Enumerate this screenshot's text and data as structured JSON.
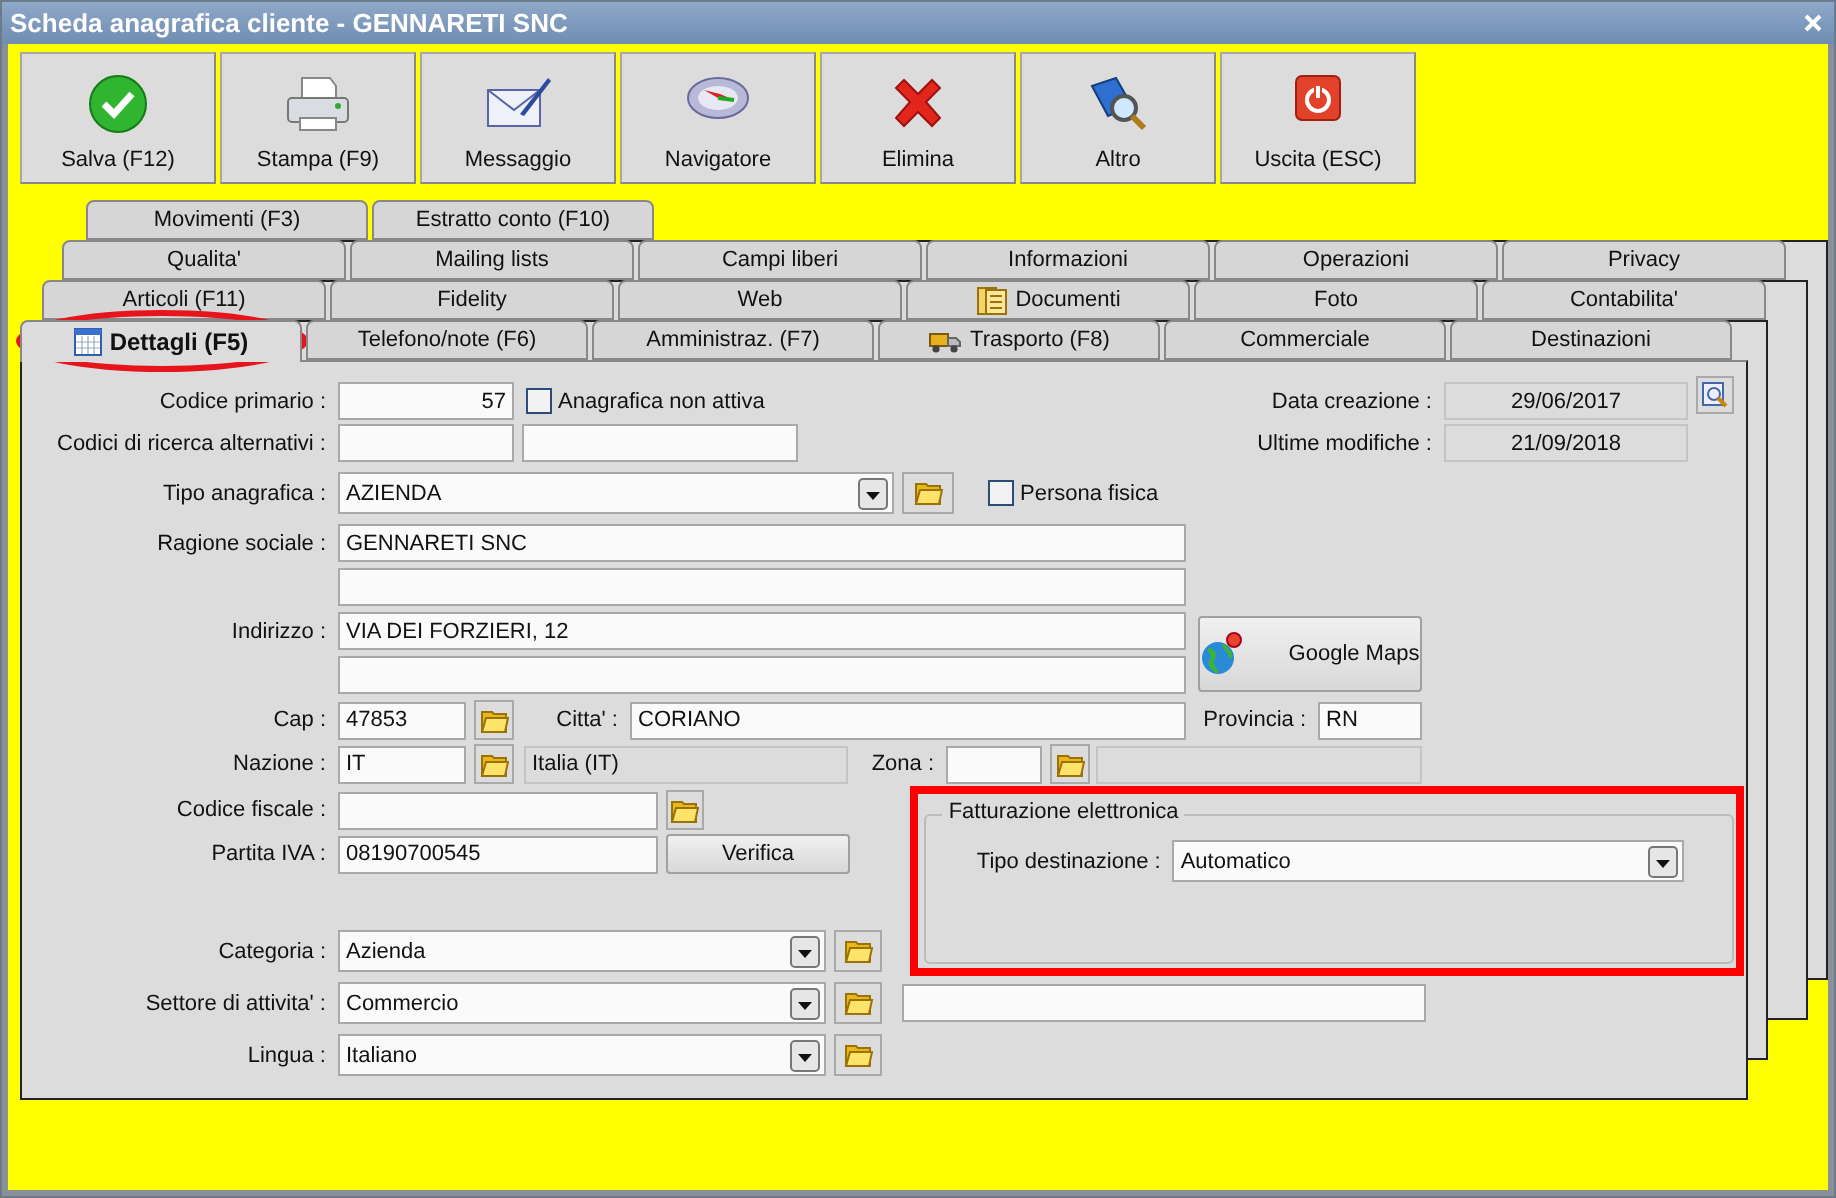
{
  "window": {
    "title": "Scheda anagrafica cliente - GENNARETI SNC"
  },
  "toolbar": [
    "Salva (F12)",
    "Stampa (F9)",
    "Messaggio",
    "Navigatore",
    "Elimina",
    "Altro",
    "Uscita (ESC)"
  ],
  "tab_rows": [
    [
      {
        "label": "Movimenti (F3)",
        "selected": false
      },
      {
        "label": "Estratto conto (F10)",
        "selected": false
      }
    ],
    [
      {
        "label": "Qualita'",
        "selected": false
      },
      {
        "label": "Mailing lists",
        "selected": false
      },
      {
        "label": "Campi liberi",
        "selected": false
      },
      {
        "label": "Informazioni",
        "selected": false
      },
      {
        "label": "Operazioni",
        "selected": false
      },
      {
        "label": "Privacy",
        "selected": false
      }
    ],
    [
      {
        "label": "Articoli (F11)",
        "selected": false
      },
      {
        "label": "Fidelity",
        "selected": false
      },
      {
        "label": "Web",
        "selected": false
      },
      {
        "label": "Documenti",
        "selected": false
      },
      {
        "label": "Foto",
        "selected": false
      },
      {
        "label": "Contabilita'",
        "selected": false
      }
    ],
    [
      {
        "label": "Dettagli (F5)",
        "selected": true
      },
      {
        "label": "Telefono/note (F6)",
        "selected": false
      },
      {
        "label": "Amministraz. (F7)",
        "selected": false
      },
      {
        "label": "Trasporto (F8)",
        "selected": false
      },
      {
        "label": "Commerciale",
        "selected": false
      },
      {
        "label": "Destinazioni",
        "selected": false
      }
    ]
  ],
  "form": {
    "codice_primario": {
      "label": "Codice primario :",
      "value": "57"
    },
    "non_attiva": {
      "label": "Anagrafica non attiva",
      "checked": false
    },
    "data_creazione": {
      "label": "Data creazione :",
      "value": "29/06/2017"
    },
    "codici_alternativi": {
      "label": "Codici di ricerca alternativi :"
    },
    "ultime_modifiche": {
      "label": "Ultime modifiche :",
      "value": "21/09/2018"
    },
    "tipo_anagrafica": {
      "label": "Tipo anagrafica :",
      "value": "AZIENDA"
    },
    "persona_fisica": {
      "label": "Persona fisica",
      "checked": false
    },
    "ragione_sociale": {
      "label": "Ragione sociale :",
      "value": "GENNARETI SNC"
    },
    "indirizzo": {
      "label": "Indirizzo :",
      "value": "VIA DEI FORZIERI, 12"
    },
    "google_maps_button": "Google Maps",
    "cap": {
      "label": "Cap :",
      "value": "47853"
    },
    "citta": {
      "label": "Citta' :",
      "value": "CORIANO"
    },
    "provincia": {
      "label": "Provincia :",
      "value": "RN"
    },
    "nazione": {
      "label": "Nazione :",
      "value": "IT",
      "description": "Italia (IT)"
    },
    "zona": {
      "label": "Zona :"
    },
    "codice_fiscale": {
      "label": "Codice fiscale :"
    },
    "partita_iva": {
      "label": "Partita IVA :",
      "value": "08190700545"
    },
    "verifica_button": "Verifica",
    "fatturazione": {
      "title": "Fatturazione elettronica",
      "label": "Tipo destinazione :",
      "value": "Automatico"
    },
    "categoria": {
      "label": "Categoria :",
      "value": "Azienda"
    },
    "settore": {
      "label": "Settore di attivita' :",
      "value": "Commercio"
    },
    "lingua": {
      "label": "Lingua :",
      "value": "Italiano"
    }
  }
}
